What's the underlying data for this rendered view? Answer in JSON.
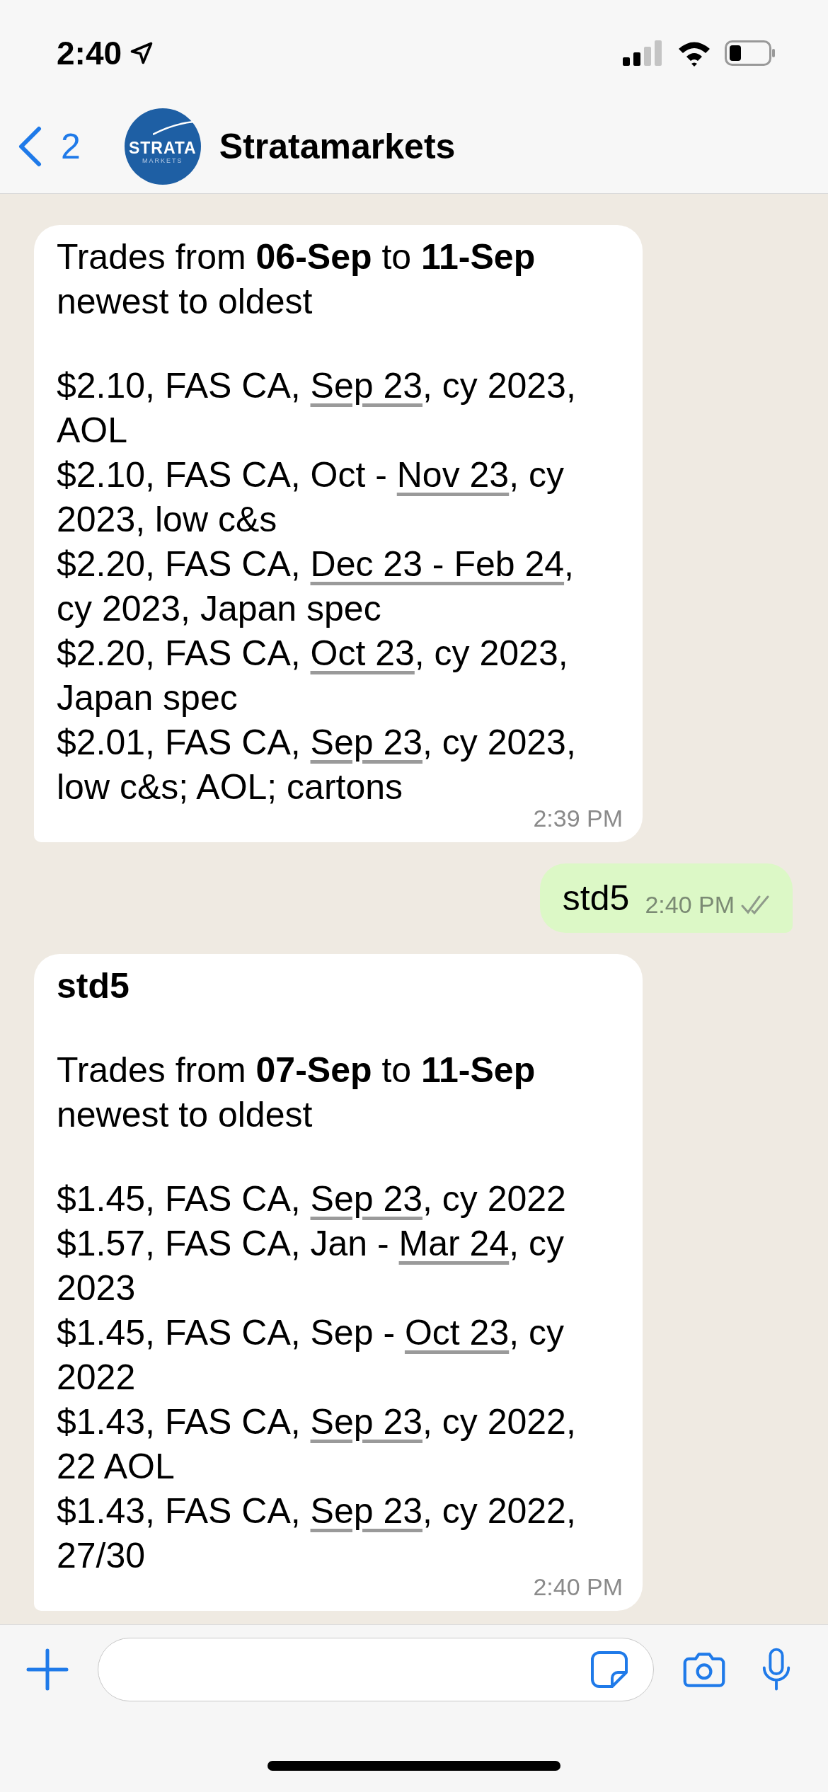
{
  "status_bar": {
    "time": "2:40"
  },
  "header": {
    "back_count": "2",
    "avatar": {
      "line_1": "STRATA",
      "line_2": "MARKETS"
    },
    "title": "Stratamarkets"
  },
  "messages": [
    {
      "kind": "received",
      "intro": [
        "Trades from **06-Sep** to **11-Sep**",
        "newest to oldest"
      ],
      "trades": [
        {
          "parts": [
            {
              "text": "$2.10, FAS CA, "
            },
            {
              "text": "Sep 23",
              "link": true
            },
            {
              "text": ", cy 2023, AOL"
            }
          ]
        },
        {
          "parts": [
            {
              "text": "$2.10, FAS CA, Oct - "
            },
            {
              "text": "Nov 23",
              "link": true
            },
            {
              "text": ", cy 2023, low c&s"
            }
          ]
        },
        {
          "parts": [
            {
              "text": "$2.20, FAS CA, "
            },
            {
              "text": "Dec 23 - Feb 24",
              "link": true
            },
            {
              "text": ", cy 2023, Japan spec"
            }
          ]
        },
        {
          "parts": [
            {
              "text": "$2.20, FAS CA, "
            },
            {
              "text": "Oct 23",
              "link": true
            },
            {
              "text": ", cy 2023, Japan spec"
            }
          ]
        },
        {
          "parts": [
            {
              "text": "$2.01, FAS CA, "
            },
            {
              "text": "Sep 23",
              "link": true
            },
            {
              "text": ", cy 2023, low c&s; AOL; cartons"
            }
          ]
        }
      ],
      "time": "2:39 PM"
    },
    {
      "kind": "sent",
      "text": "std5",
      "time": "2:40 PM",
      "read": false
    },
    {
      "kind": "received",
      "title": "std5",
      "intro": [
        "Trades from **07-Sep** to **11-Sep**",
        "newest to oldest"
      ],
      "trades": [
        {
          "parts": [
            {
              "text": "$1.45, FAS CA, "
            },
            {
              "text": "Sep 23",
              "link": true
            },
            {
              "text": ", cy 2022"
            }
          ]
        },
        {
          "parts": [
            {
              "text": "$1.57, FAS CA, Jan - "
            },
            {
              "text": "Mar 24",
              "link": true
            },
            {
              "text": ", cy 2023"
            }
          ]
        },
        {
          "parts": [
            {
              "text": "$1.45, FAS CA, Sep - "
            },
            {
              "text": "Oct 23",
              "link": true
            },
            {
              "text": ", cy 2022"
            }
          ]
        },
        {
          "parts": [
            {
              "text": "$1.43, FAS CA, "
            },
            {
              "text": "Sep 23",
              "link": true
            },
            {
              "text": ", cy 2022, 22 AOL"
            }
          ]
        },
        {
          "parts": [
            {
              "text": "$1.43, FAS CA, "
            },
            {
              "text": "Sep 23",
              "link": true
            },
            {
              "text": ", cy 2022, 27/30"
            }
          ]
        }
      ],
      "time": "2:40 PM"
    }
  ]
}
